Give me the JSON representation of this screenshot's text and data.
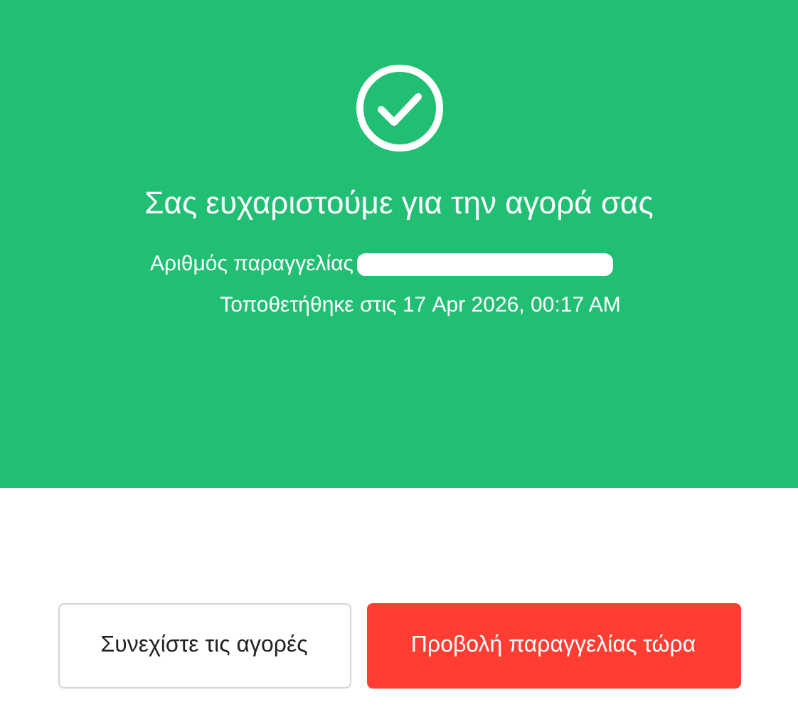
{
  "confirmation": {
    "title": "Σας ευχαριστούμε για την αγορά σας",
    "order_label": "Αριθμός παραγγελίας",
    "placed": "Τοποθετήθηκε στις 17 Apr 2026, 00:17 AM"
  },
  "buttons": [
    {
      "label": "Συνεχίστε τις αγορές",
      "kind": "secondary"
    },
    {
      "label": "Προβολή παραγγελίας τώρα",
      "kind": "primary"
    }
  ]
}
